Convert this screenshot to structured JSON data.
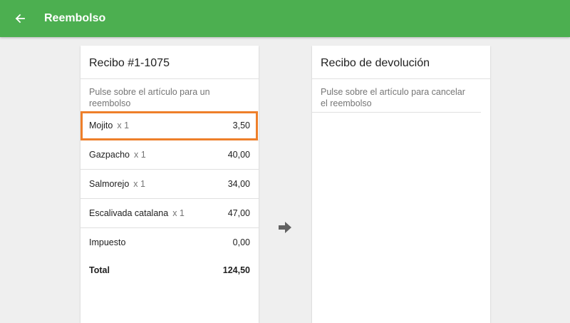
{
  "header": {
    "title": "Reembolso",
    "back_icon": "arrow-left-icon"
  },
  "receipt": {
    "title": "Recibo #1-1075",
    "hint": "Pulse sobre el artículo para un reembolso",
    "items": [
      {
        "name": "Mojito",
        "qty": "x 1",
        "price": "3,50"
      },
      {
        "name": "Gazpacho",
        "qty": "x 1",
        "price": "40,00"
      },
      {
        "name": "Salmorejo",
        "qty": "x 1",
        "price": "34,00"
      },
      {
        "name": "Escalivada catalana",
        "qty": "x 1",
        "price": "47,00"
      }
    ],
    "tax_label": "Impuesto",
    "tax_value": "0,00",
    "total_label": "Total",
    "total_value": "124,50"
  },
  "refund": {
    "title": "Recibo de devolución",
    "hint": "Pulse sobre el artículo para cancelar el reembolso"
  },
  "colors": {
    "appbar": "#4caf50",
    "highlight": "#ee7f2a",
    "arrow": "#616161"
  }
}
